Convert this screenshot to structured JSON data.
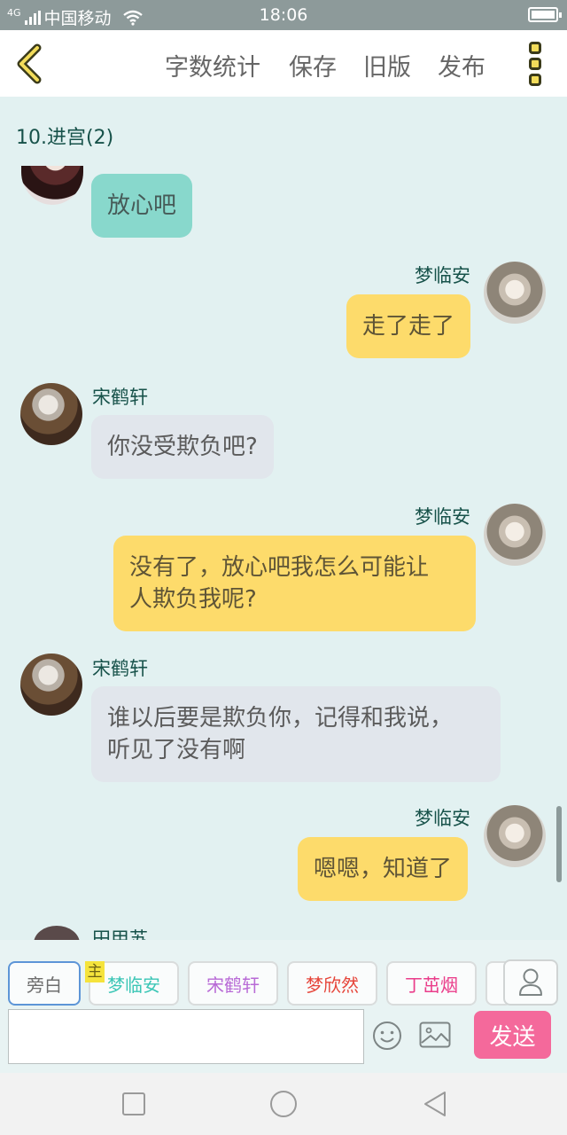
{
  "status_bar": {
    "network": "4G",
    "carrier": "中国移动",
    "time": "18:06",
    "icons": [
      "signal-icon",
      "wifi-icon",
      "battery-icon"
    ]
  },
  "header": {
    "actions": [
      "字数统计",
      "保存",
      "旧版",
      "发布"
    ],
    "back_icon": "chevron-left-icon",
    "more_icon": "more-vertical-icon"
  },
  "chat": {
    "chapter_title": "10.进宫(2)",
    "messages": [
      {
        "sender": "",
        "side": "left",
        "text": "放心吧",
        "style": "teal"
      },
      {
        "sender": "梦临安",
        "side": "right",
        "text": "走了走了",
        "style": "yellow"
      },
      {
        "sender": "宋鹤轩",
        "side": "left",
        "text": "你没受欺负吧?",
        "style": "grey"
      },
      {
        "sender": "梦临安",
        "side": "right",
        "text_lines": [
          "没有了，放心吧我怎么可能让",
          "人欺负我呢?"
        ],
        "style": "yellow"
      },
      {
        "sender": "宋鹤轩",
        "side": "left",
        "text_lines": [
          "谁以后要是欺负你，记得和我说，",
          "听见了没有啊"
        ],
        "style": "grey"
      },
      {
        "sender": "梦临安",
        "side": "right",
        "text": "嗯嗯，知道了",
        "style": "yellow"
      },
      {
        "sender": "田甲苏",
        "side": "left",
        "text": "",
        "style": "partial"
      }
    ]
  },
  "role_bar": {
    "narrator_label": "旁白",
    "main_badge": "主",
    "roles": [
      {
        "name": "梦临安",
        "color": "#3cc6b6"
      },
      {
        "name": "宋鹤轩",
        "color": "#b86ad6"
      },
      {
        "name": "梦欣然",
        "color": "#e6453a"
      },
      {
        "name": "丁茁烟",
        "color": "#ea3d8a"
      }
    ],
    "person_icon": "person-icon"
  },
  "composer": {
    "input_value": "",
    "input_placeholder": "",
    "send_label": "发送",
    "emoji_icon": "emoji-icon",
    "image_icon": "image-icon"
  },
  "nav": {
    "icons": [
      "recent-apps-icon",
      "home-icon",
      "back-icon"
    ]
  },
  "colors": {
    "chat_bg": "#e2f1f1",
    "bubble_yellow": "#fddb6b",
    "bubble_grey": "#e1e6ec",
    "bubble_teal": "#88d8cc",
    "send_button": "#f4699b",
    "name_text": "#17524a"
  }
}
